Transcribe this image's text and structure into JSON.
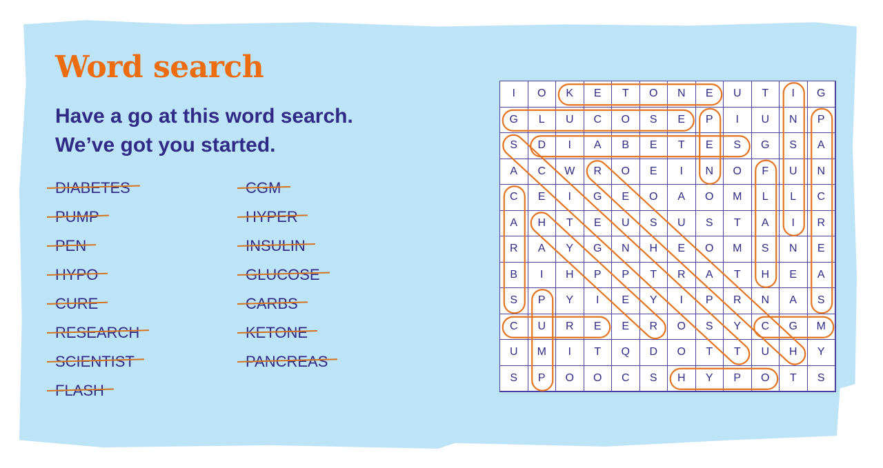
{
  "title": "Word search",
  "subtitle": [
    "Have a go at this word search.",
    "We’ve got you started."
  ],
  "word_list": {
    "column1": [
      "DIABETES",
      "PUMP",
      "PEN",
      "HYPO",
      "CURE",
      "RESEARCH",
      "SCIENTIST",
      "FLASH"
    ],
    "column2": [
      "CGM",
      "HYPER",
      "INSULIN",
      "GLUCOSE",
      "CARBS",
      "KETONE",
      "PANCREAS"
    ],
    "all_crossed_out": true
  },
  "grid": {
    "rows": [
      "IOKETONEUTIG",
      "GLUCOSEPIUNP",
      "SDIABETESGSA",
      "ACWROEINOFUN",
      "CEIGEOAOMLLC",
      "AHTEUSUSTAIR",
      "RAYGNHEOMSNE",
      "BIHPPTRATHEA",
      "SPYIEYIPRNAS",
      "CUREEROSYCGM",
      "UMITQDOTTUHY",
      "SPOOCSHYPOTS"
    ],
    "found_words": [
      {
        "word": "KETONE",
        "start": [
          0,
          2
        ],
        "end": [
          0,
          7
        ]
      },
      {
        "word": "GLUCOSE",
        "start": [
          1,
          0
        ],
        "end": [
          1,
          6
        ]
      },
      {
        "word": "DIABETES",
        "start": [
          2,
          1
        ],
        "end": [
          2,
          8
        ]
      },
      {
        "word": "INSULIN",
        "start": [
          0,
          10
        ],
        "end": [
          5,
          10
        ]
      },
      {
        "word": "PANCREAS",
        "start": [
          1,
          11
        ],
        "end": [
          8,
          11
        ]
      },
      {
        "word": "PEN",
        "start": [
          1,
          7
        ],
        "end": [
          3,
          7
        ]
      },
      {
        "word": "FLASH",
        "start": [
          3,
          9
        ],
        "end": [
          7,
          9
        ]
      },
      {
        "word": "CARBS",
        "start": [
          4,
          0
        ],
        "end": [
          8,
          0
        ]
      },
      {
        "word": "PUMP",
        "start": [
          8,
          1
        ],
        "end": [
          11,
          1
        ]
      },
      {
        "word": "CURE",
        "start": [
          9,
          0
        ],
        "end": [
          9,
          3
        ]
      },
      {
        "word": "CGM",
        "start": [
          9,
          9
        ],
        "end": [
          9,
          11
        ]
      },
      {
        "word": "HYPO",
        "start": [
          11,
          6
        ],
        "end": [
          11,
          9
        ]
      },
      {
        "word": "HYPER",
        "start": [
          5,
          1
        ],
        "end": [
          9,
          5
        ]
      },
      {
        "word": "RESEARCH",
        "start": [
          3,
          3
        ],
        "end": [
          10,
          10
        ]
      },
      {
        "word": "SCIENTIST",
        "start": [
          2,
          0
        ],
        "end": [
          10,
          8
        ]
      }
    ]
  },
  "colors": {
    "panel_bg": "#bde3f6",
    "title": "#ec6c0f",
    "text": "#2e2a85",
    "ring": "#e4731e",
    "strike": "#d4731d",
    "grid_line": "#4b3fa0"
  }
}
